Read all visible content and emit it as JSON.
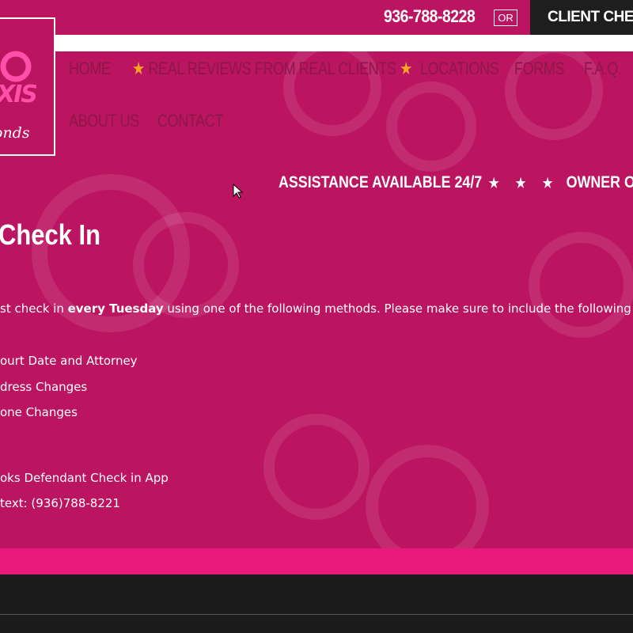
{
  "topbar": {
    "phone": "936-788-8228",
    "or_label": "OR",
    "checkin_label": "CLIENT CHECK I"
  },
  "logo": {
    "text_main": "XIS",
    "text_sub": "onds"
  },
  "nav": {
    "items": [
      "HOME",
      "REAL REVIEWS FROM REAL CLIENTS",
      "LOCATIONS",
      "FORMS",
      "F.A.Q.",
      "ABOUT US",
      "CONTACT"
    ],
    "star_icon": "star-icon"
  },
  "ticker": {
    "left": "ASSISTANCE AVAILABLE 24/7",
    "stars": "★ ★ ★",
    "right": "OWNER OPERATED DA"
  },
  "main": {
    "title": "Check In",
    "para_prefix": "st check in ",
    "para_bold": "every Tuesday",
    "para_suffix": " using one of the following methods. Please make sure to include the following informat",
    "info_items": [
      "ourt Date and Attorney",
      "dress Changes",
      "one Changes"
    ],
    "methods": [
      "oks Defendant Check in App",
      "text:  (936)788-8221"
    ]
  },
  "colors": {
    "background": "#bb1460",
    "accent_band": "#e8197a",
    "footer": "#1c1c1c",
    "nav_text": "#8c1848",
    "star": "#f5a623"
  }
}
